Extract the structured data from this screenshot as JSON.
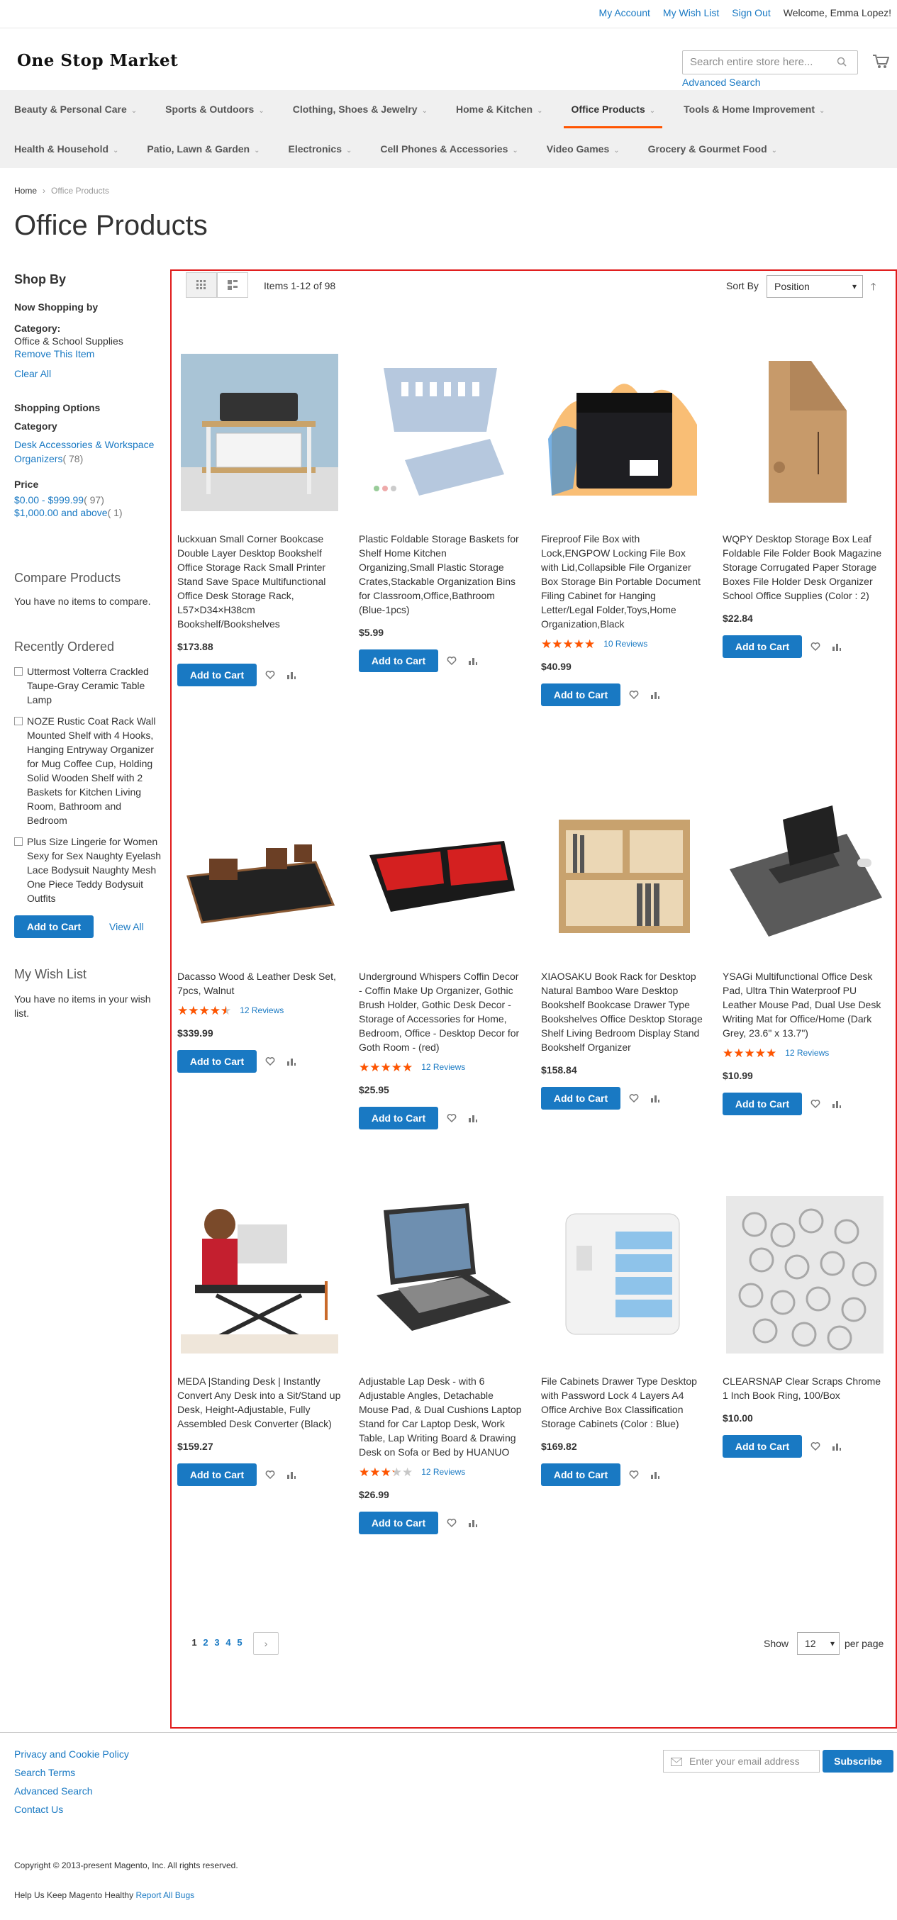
{
  "top_links": {
    "account": "My Account",
    "wishlist": "My Wish List",
    "signout": "Sign Out",
    "welcome": "Welcome, Emma Lopez!"
  },
  "header": {
    "logo": "One Stop Market",
    "search_placeholder": "Search entire store here...",
    "advanced_search": "Advanced Search"
  },
  "nav": {
    "row1": [
      "Beauty & Personal Care",
      "Sports & Outdoors",
      "Clothing, Shoes & Jewelry",
      "Home & Kitchen",
      "Office Products",
      "Tools & Home Improvement"
    ],
    "row2": [
      "Health & Household",
      "Patio, Lawn & Garden",
      "Electronics",
      "Cell Phones & Accessories",
      "Video Games",
      "Grocery & Gourmet Food"
    ],
    "active": "Office Products"
  },
  "breadcrumb": {
    "home": "Home",
    "current": "Office Products"
  },
  "page_title": "Office Products",
  "sidebar": {
    "shop_by": "Shop By",
    "now_shopping": "Now Shopping by",
    "filter_label": "Category:",
    "filter_value": "Office & School Supplies",
    "remove": "Remove This Item",
    "clear_all": "Clear All",
    "shopping_options": "Shopping Options",
    "category_heading": "Category",
    "category_link": "Desk Accessories & Workspace Organizers",
    "category_count": "( 78)",
    "price_heading": "Price",
    "price1": "$0.00 - $999.99",
    "price1_count": "( 97)",
    "price2": "$1,000.00 and above",
    "price2_count": "( 1)",
    "compare_title": "Compare Products",
    "compare_text": "You have no items to compare.",
    "recent_title": "Recently Ordered",
    "recent": [
      "Uttermost Volterra Crackled Taupe-Gray Ceramic Table Lamp",
      "NOZE Rustic Coat Rack Wall Mounted Shelf with 4 Hooks, Hanging Entryway Organizer for Mug Coffee Cup, Holding Solid Wooden Shelf with 2 Baskets for Kitchen Living Room, Bathroom and Bedroom",
      "Plus Size Lingerie for Women Sexy for Sex Naughty Eyelash Lace Bodysuit Naughty Mesh One Piece Teddy Bodysuit Outfits"
    ],
    "add_to_cart": "Add to Cart",
    "view_all": "View All",
    "wishlist_title": "My Wish List",
    "wishlist_text": "You have no items in your wish list."
  },
  "toolbar": {
    "items": "Items 1-12 of 98",
    "sort_by": "Sort By",
    "sort_value": "Position",
    "show": "Show",
    "limit": "12",
    "per_page": "per page"
  },
  "products": [
    {
      "name": "luckxuan Small Corner Bookcase Double Layer Desktop Bookshelf Office Storage Rack Small Printer Stand Save Space Multifunctional Office Desk Storage Rack, L57×D34×H38cm Bookshelf/Bookshelves",
      "price": "$173.88",
      "rating": null,
      "reviews": ""
    },
    {
      "name": "Plastic Foldable Storage Baskets for Shelf Home Kitchen Organizing,Small Plastic Storage Crates,Stackable Organization Bins for Classroom,Office,Bathroom (Blue-1pcs)",
      "price": "$5.99",
      "rating": null,
      "reviews": ""
    },
    {
      "name": "Fireproof File Box with Lock,ENGPOW Locking File Box with Lid,Collapsible File Organizer Box Storage Bin Portable Document Filing Cabinet for Hanging Letter/Legal Folder,Toys,Home Organization,Black",
      "price": "$40.99",
      "rating": 100,
      "reviews": "10  Reviews"
    },
    {
      "name": "WQPY Desktop Storage Box Leaf Foldable File Folder Book Magazine Storage Corrugated Paper Storage Boxes File Holder Desk Organizer School Office Supplies (Color : 2)",
      "price": "$22.84",
      "rating": null,
      "reviews": ""
    },
    {
      "name": "Dacasso Wood & Leather Desk Set, 7pcs, Walnut",
      "price": "$339.99",
      "rating": 90,
      "reviews": "12  Reviews"
    },
    {
      "name": "Underground Whispers Coffin Decor - Coffin Make Up Organizer, Gothic Brush Holder, Gothic Desk Decor - Storage of Accessories for Home, Bedroom, Office - Desktop Decor for Goth Room - (red)",
      "price": "$25.95",
      "rating": 100,
      "reviews": "12  Reviews"
    },
    {
      "name": "XIAOSAKU Book Rack for Desktop Natural Bamboo Ware Desktop Bookshelf Bookcase Drawer Type Bookshelves Office Desktop Storage Shelf Living Bedroom Display Stand Bookshelf Organizer",
      "price": "$158.84",
      "rating": null,
      "reviews": ""
    },
    {
      "name": "YSAGi Multifunctional Office Desk Pad, Ultra Thin Waterproof PU Leather Mouse Pad, Dual Use Desk Writing Mat for Office/Home (Dark Grey, 23.6\" x 13.7\")",
      "price": "$10.99",
      "rating": 100,
      "reviews": "12  Reviews"
    },
    {
      "name": "MEDA |Standing Desk | Instantly Convert Any Desk into a Sit/Stand up Desk, Height-Adjustable, Fully Assembled Desk Converter (Black)",
      "price": "$159.27",
      "rating": null,
      "reviews": ""
    },
    {
      "name": "Adjustable Lap Desk - with 6 Adjustable Angles, Detachable Mouse Pad, & Dual Cushions Laptop Stand for Car Laptop Desk, Work Table, Lap Writing Board & Drawing Desk on Sofa or Bed by HUANUO",
      "price": "$26.99",
      "rating": 65,
      "reviews": "12  Reviews"
    },
    {
      "name": "File Cabinets Drawer Type Desktop with Password Lock 4 Layers A4 Office Archive Box Classification Storage Cabinets (Color : Blue)",
      "price": "$169.82",
      "rating": null,
      "reviews": ""
    },
    {
      "name": "CLEARSNAP Clear Scraps Chrome 1 Inch Book Ring, 100/Box",
      "price": "$10.00",
      "rating": null,
      "reviews": ""
    }
  ],
  "add_to_cart": "Add to Cart",
  "pages": [
    "1",
    "2",
    "3",
    "4",
    "5"
  ],
  "footer": {
    "links": [
      "Privacy and Cookie Policy",
      "Search Terms",
      "Advanced Search",
      "Contact Us"
    ],
    "email_placeholder": "Enter your email address",
    "subscribe": "Subscribe",
    "copyright": "Copyright © 2013-present Magento, Inc. All rights reserved.",
    "help_text": "Help Us Keep Magento Healthy",
    "report_bugs": "Report All Bugs"
  },
  "colors": {
    "accent": "#1979c3",
    "nav_active": "#ff5501",
    "star": "#ff5501",
    "highlight_border": "#e01b1b"
  }
}
